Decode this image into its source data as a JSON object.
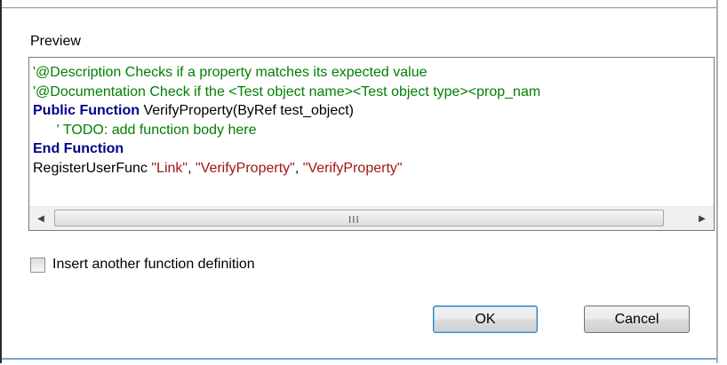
{
  "preview": {
    "label": "Preview",
    "code_lines": [
      [
        {
          "t": "'@Description Checks if a property matches its expected value",
          "c": "comment"
        }
      ],
      [
        {
          "t": "'@Documentation Check if the <Test object name><Test object type><prop_nam",
          "c": "comment"
        }
      ],
      [
        {
          "t": "Public Function",
          "c": "keyword"
        },
        {
          "t": " VerifyProperty(ByRef test_object)",
          "c": "plain"
        }
      ],
      [
        {
          "t": "      ' TODO: add function body here",
          "c": "comment"
        }
      ],
      [
        {
          "t": "End Function",
          "c": "keyword"
        }
      ],
      [
        {
          "t": "RegisterUserFunc ",
          "c": "plain"
        },
        {
          "t": "\"Link\"",
          "c": "string"
        },
        {
          "t": ", ",
          "c": "plain"
        },
        {
          "t": "\"VerifyProperty\"",
          "c": "string"
        },
        {
          "t": ", ",
          "c": "plain"
        },
        {
          "t": "\"VerifyProperty\"",
          "c": "string"
        }
      ]
    ],
    "scrollbar": {
      "left_arrow": "◀",
      "right_arrow": "▶",
      "grip": "III"
    }
  },
  "checkbox": {
    "label": "Insert another function definition",
    "checked": false
  },
  "buttons": {
    "ok_label": "OK",
    "cancel_label": "Cancel"
  },
  "colors": {
    "comment": "#008000",
    "keyword": "#00008B",
    "string": "#A31515",
    "plain": "#000000"
  }
}
